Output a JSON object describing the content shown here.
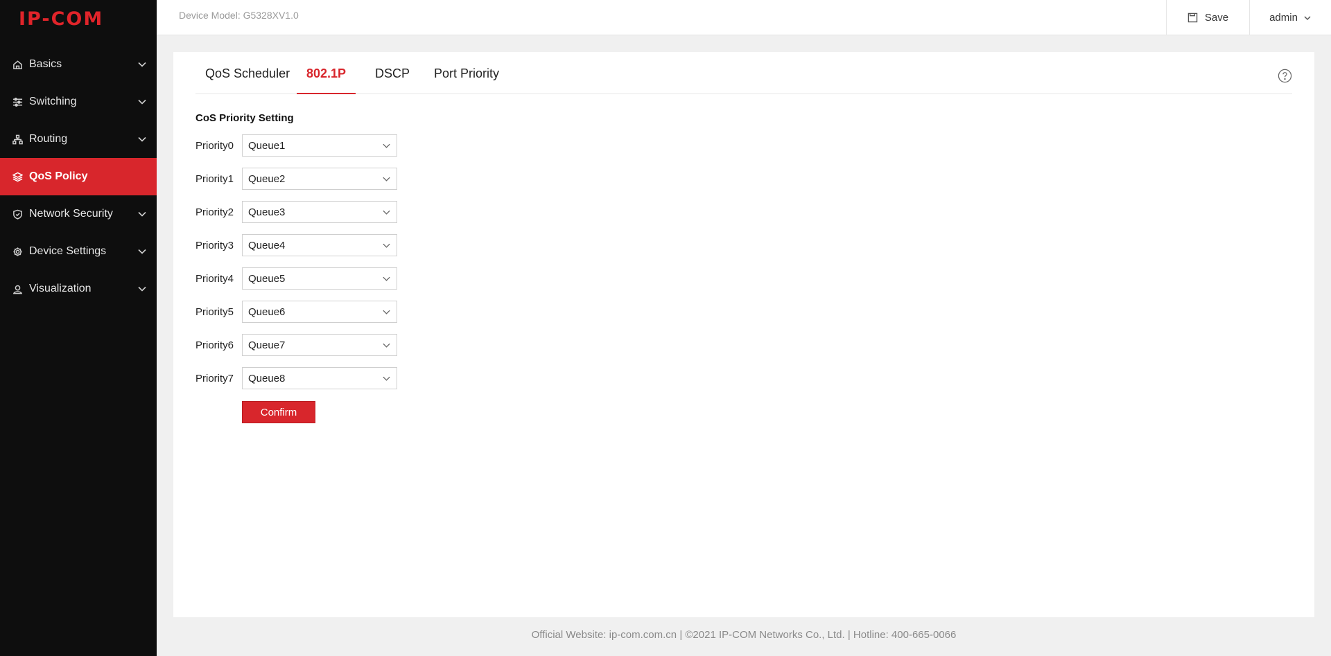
{
  "brand": {
    "logo_text": "IP-COM",
    "accent": "#d8262c"
  },
  "header": {
    "device_model": "Device Model: G5328XV1.0",
    "save_label": "Save",
    "user_label": "admin"
  },
  "sidebar": {
    "items": [
      {
        "label": "Basics",
        "icon": "home-icon"
      },
      {
        "label": "Switching",
        "icon": "sliders-icon"
      },
      {
        "label": "Routing",
        "icon": "network-icon"
      },
      {
        "label": "QoS Policy",
        "icon": "layers-icon",
        "active": true
      },
      {
        "label": "Network Security",
        "icon": "shield-icon"
      },
      {
        "label": "Device Settings",
        "icon": "gear-icon"
      },
      {
        "label": "Visualization",
        "icon": "user-icon"
      }
    ]
  },
  "tabs": [
    {
      "label": "QoS Scheduler"
    },
    {
      "label": "802.1P",
      "active": true
    },
    {
      "label": "DSCP"
    },
    {
      "label": "Port Priority"
    }
  ],
  "section": {
    "title": "CoS Priority Setting",
    "rows": [
      {
        "label": "Priority0",
        "value": "Queue1"
      },
      {
        "label": "Priority1",
        "value": "Queue2"
      },
      {
        "label": "Priority2",
        "value": "Queue3"
      },
      {
        "label": "Priority3",
        "value": "Queue4"
      },
      {
        "label": "Priority4",
        "value": "Queue5"
      },
      {
        "label": "Priority5",
        "value": "Queue6"
      },
      {
        "label": "Priority6",
        "value": "Queue7"
      },
      {
        "label": "Priority7",
        "value": "Queue8"
      }
    ],
    "confirm_label": "Confirm"
  },
  "footer": {
    "text": "Official Website: ip-com.com.cn | ©2021 IP-COM Networks Co., Ltd. | Hotline: 400-665-0066"
  }
}
